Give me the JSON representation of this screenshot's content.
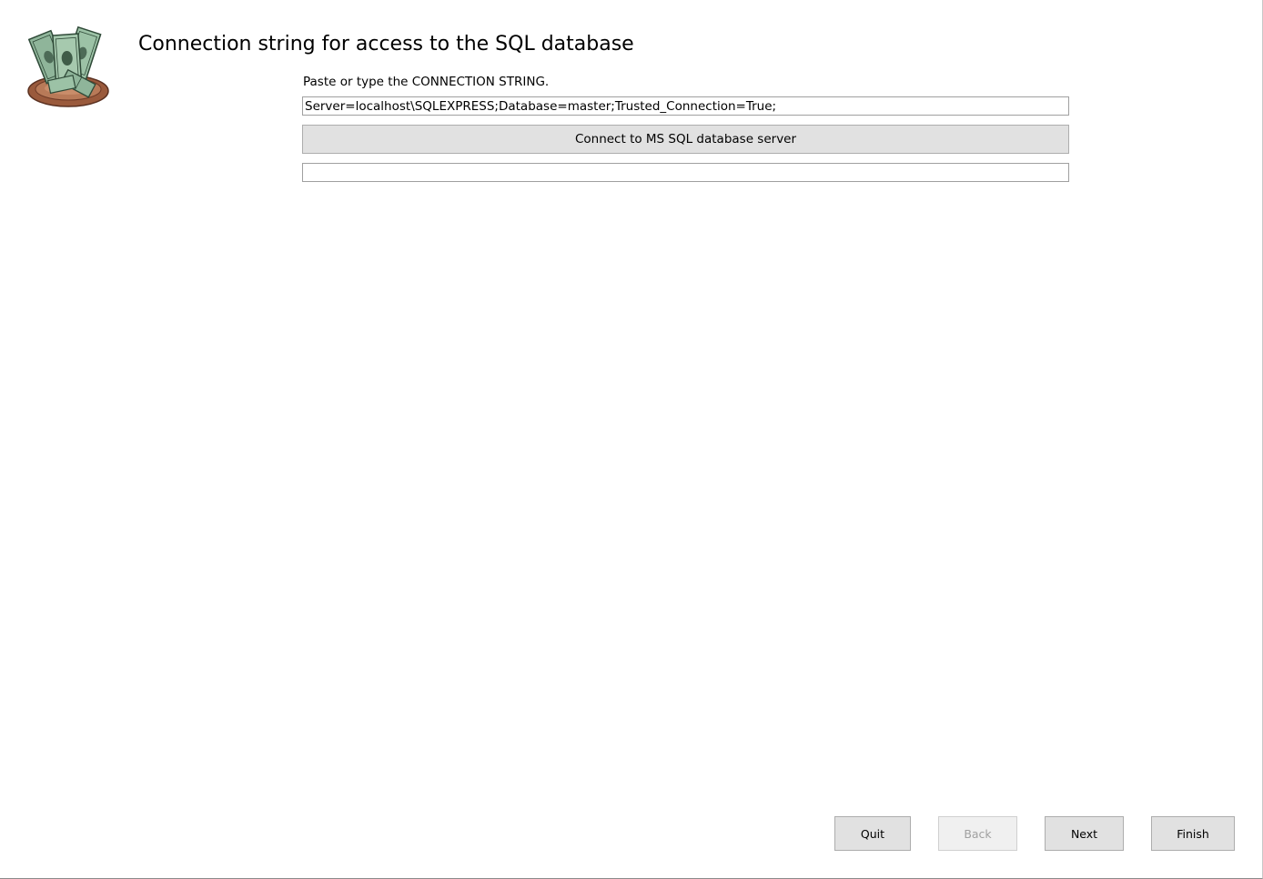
{
  "header": {
    "title": "Connection string for access to the SQL database",
    "logo_icon": "money-bills-on-plate-icon"
  },
  "form": {
    "prompt": "Paste or type the CONNECTION STRING.",
    "connection_string_value": "Server=localhost\\SQLEXPRESS;Database=master;Trusted_Connection=True;",
    "connect_button_label": "Connect to MS SQL database server",
    "status_value": ""
  },
  "footer": {
    "quit_label": "Quit",
    "back_label": "Back",
    "back_enabled": false,
    "next_label": "Next",
    "finish_label": "Finish"
  },
  "colors": {
    "button_face": "#e1e1e1",
    "button_border": "#adadad",
    "disabled_text": "#a0a0a0",
    "bill_green": "#8fb59a",
    "plate_brown": "#9a5a3c"
  }
}
